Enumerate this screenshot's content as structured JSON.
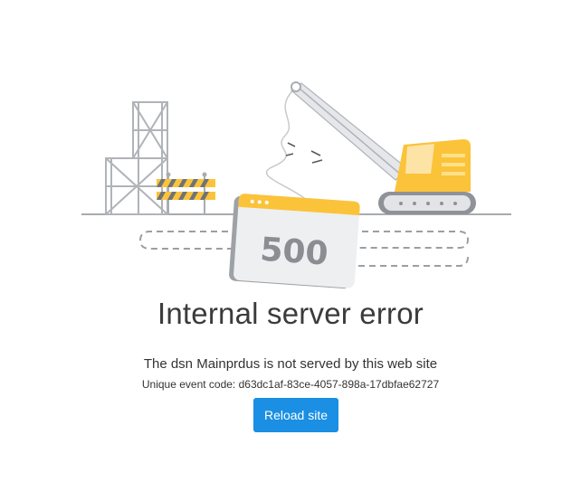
{
  "error": {
    "code": "500",
    "title": "Internal server error",
    "message": "The dsn Mainprdus is not served by this web site",
    "event_code_text": "Unique event code: d63dc1af-83ce-4057-898a-17dbfae62727"
  },
  "actions": {
    "reload_label": "Reload site"
  },
  "colors": {
    "accent": "#1a8fe3",
    "yellow": "#fbc33a",
    "gray_structure": "#a9acb1",
    "dark_text": "#3b3b3b"
  }
}
